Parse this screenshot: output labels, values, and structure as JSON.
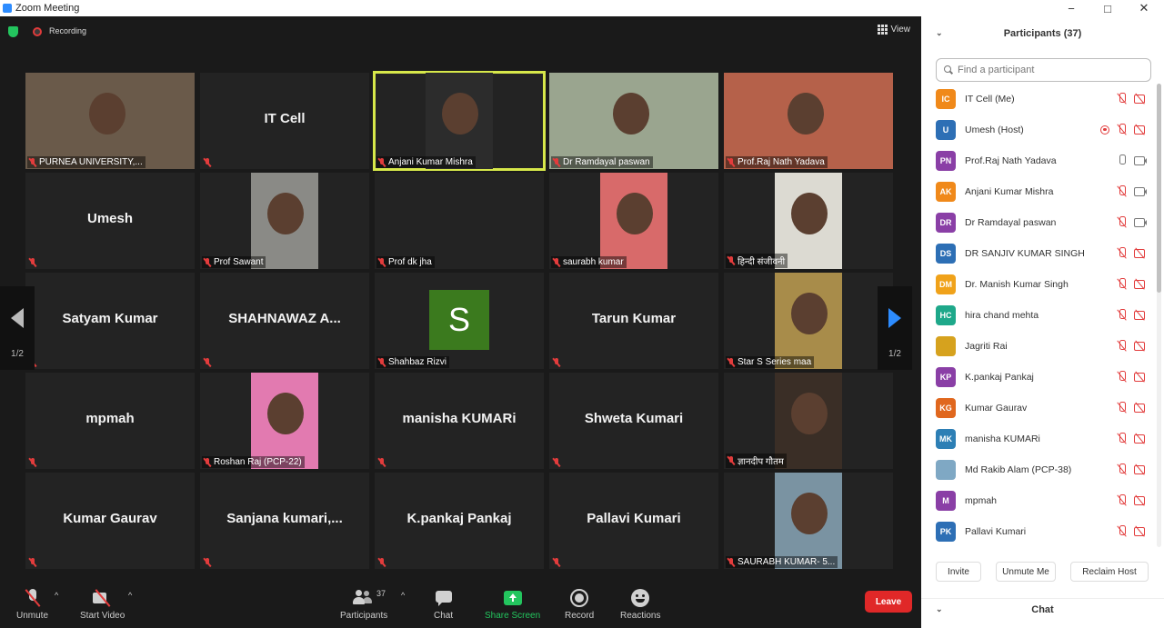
{
  "window": {
    "title": "Zoom Meeting",
    "minimize": "−",
    "maximize": "□",
    "close": "✕"
  },
  "topbar": {
    "recording_label": "Recording",
    "view_label": "View"
  },
  "tiles": [
    {
      "name": "PURNEA UNIVERSITY,...",
      "video": true,
      "bg": "#6a5a4a"
    },
    {
      "name": "",
      "big": "IT Cell",
      "video": false
    },
    {
      "name": "Anjani Kumar Mishra",
      "video": true,
      "bg": "#2c2c2c",
      "active": true
    },
    {
      "name": "Dr Ramdayal paswan",
      "video": true,
      "bg": "#9aa58f"
    },
    {
      "name": "Prof.Raj Nath Yadava",
      "video": true,
      "bg": "#b5614a"
    },
    {
      "name": "",
      "big": "Umesh",
      "video": false
    },
    {
      "name": "Prof Sawant",
      "video": true,
      "bg": "#8a8a86"
    },
    {
      "name": "Prof dk jha",
      "video": false,
      "big": ""
    },
    {
      "name": "saurabh kumar",
      "video": true,
      "bg": "#d86a6a"
    },
    {
      "name": "हिन्दी संजीवनी",
      "video": true,
      "bg": "#dcdad2"
    },
    {
      "name": "",
      "big": "Satyam Kumar",
      "video": false
    },
    {
      "name": "",
      "big": "SHAHNAWAZ  A...",
      "video": false
    },
    {
      "name": "Shahbaz Rizvi",
      "video": false,
      "letter": "S"
    },
    {
      "name": "",
      "big": "Tarun Kumar",
      "video": false
    },
    {
      "name": "Star S Series maa",
      "video": true,
      "bg": "#a88c4a"
    },
    {
      "name": "",
      "big": "mpmah",
      "video": false
    },
    {
      "name": "Roshan Raj (PCP-22)",
      "video": true,
      "bg": "#e27ab0"
    },
    {
      "name": "",
      "big": "manisha KUMARi",
      "video": false
    },
    {
      "name": "",
      "big": "Shweta Kumari",
      "video": false
    },
    {
      "name": "ज्ञानदीप गौतम",
      "video": true,
      "bg": "#3a2e26"
    },
    {
      "name": "",
      "big": "Kumar Gaurav",
      "video": false
    },
    {
      "name": "",
      "big": "Sanjana  kumari,...",
      "video": false
    },
    {
      "name": "",
      "big": "K.pankaj Pankaj",
      "video": false
    },
    {
      "name": "",
      "big": "Pallavi Kumari",
      "video": false
    },
    {
      "name": "SAURABH KUMAR- 5...",
      "video": true,
      "bg": "#7a93a2"
    }
  ],
  "nav": {
    "page_left": "1/2",
    "page_right": "1/2"
  },
  "toolbar": {
    "unmute": "Unmute",
    "start_video": "Start Video",
    "participants": "Participants",
    "participants_count": "37",
    "chat": "Chat",
    "share_screen": "Share Screen",
    "record": "Record",
    "reactions": "Reactions",
    "leave": "Leave",
    "caret": "^"
  },
  "panel": {
    "title": "Participants (37)",
    "search_placeholder": "Find a participant",
    "participants": [
      {
        "initials": "IC",
        "name": "IT Cell (Me)",
        "color": "#f0891a",
        "mic": "off",
        "cam": "off"
      },
      {
        "initials": "U",
        "name": "Umesh (Host)",
        "color": "#2d6fb5",
        "mic": "off",
        "cam": "off",
        "rec": true
      },
      {
        "initials": "PN",
        "name": "Prof.Raj Nath Yadava",
        "color": "#8a3fa6",
        "mic": "on",
        "cam": "on"
      },
      {
        "initials": "AK",
        "name": "Anjani Kumar Mishra",
        "color": "#f0891a",
        "mic": "off",
        "cam": "on"
      },
      {
        "initials": "DR",
        "name": "Dr Ramdayal paswan",
        "color": "#8a3fa6",
        "mic": "off",
        "cam": "on"
      },
      {
        "initials": "DS",
        "name": "DR SANJIV KUMAR SINGH",
        "color": "#2d6fb5",
        "mic": "off",
        "cam": "off"
      },
      {
        "initials": "DM",
        "name": "Dr. Manish Kumar Singh",
        "color": "#f0a21a",
        "mic": "off",
        "cam": "off"
      },
      {
        "initials": "HC",
        "name": "hira chand mehta",
        "color": "#1ea88a",
        "mic": "off",
        "cam": "off"
      },
      {
        "initials": "",
        "name": "Jagriti Rai",
        "color": "#d6a21e",
        "mic": "off",
        "cam": "off"
      },
      {
        "initials": "KP",
        "name": "K.pankaj Pankaj",
        "color": "#8a3fa6",
        "mic": "off",
        "cam": "off"
      },
      {
        "initials": "KG",
        "name": "Kumar Gaurav",
        "color": "#e0671e",
        "mic": "off",
        "cam": "off"
      },
      {
        "initials": "MK",
        "name": "manisha KUMARi",
        "color": "#2d7fb5",
        "mic": "off",
        "cam": "off"
      },
      {
        "initials": "",
        "name": "Md Rakib Alam (PCP-38)",
        "color": "#7fa8c4",
        "mic": "off",
        "cam": "off"
      },
      {
        "initials": "M",
        "name": "mpmah",
        "color": "#8a3fa6",
        "mic": "off",
        "cam": "off"
      },
      {
        "initials": "PK",
        "name": "Pallavi Kumari",
        "color": "#2d6fb5",
        "mic": "off",
        "cam": "off"
      }
    ],
    "invite": "Invite",
    "unmute_me": "Unmute Me",
    "reclaim_host": "Reclaim Host",
    "chat_title": "Chat",
    "chevron": "⌄"
  }
}
